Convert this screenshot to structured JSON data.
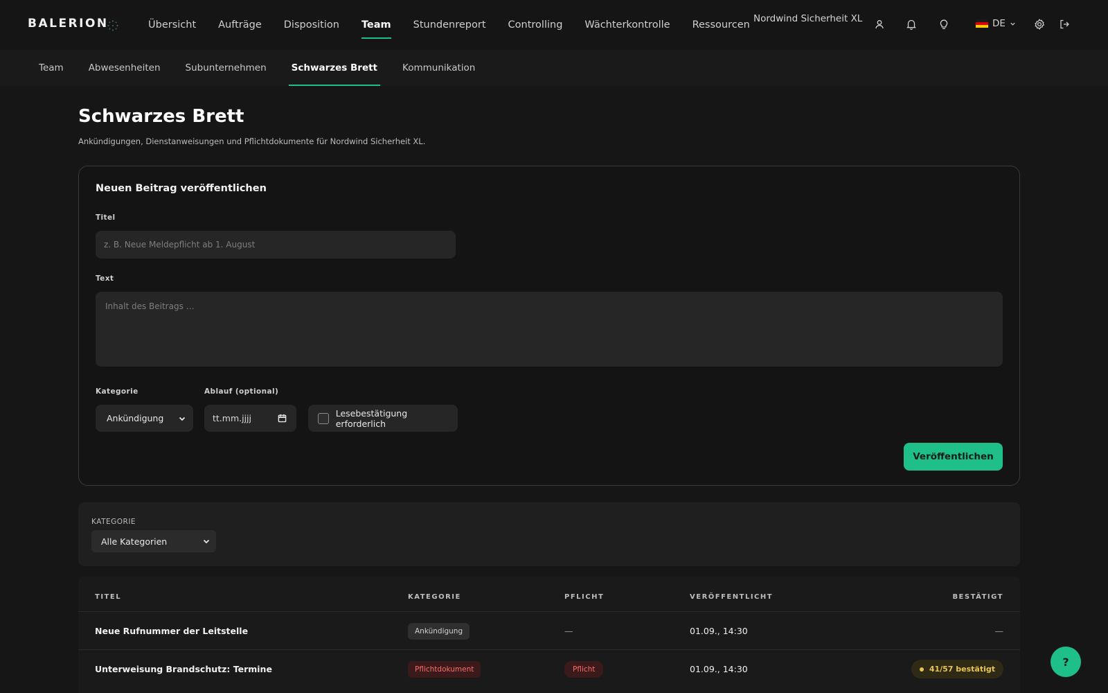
{
  "brand": {
    "logo": "BALERION",
    "logo_icon": "dots-icon"
  },
  "main_nav": [
    {
      "label": "Übersicht",
      "active": false
    },
    {
      "label": "Aufträge",
      "active": false
    },
    {
      "label": "Disposition",
      "active": false
    },
    {
      "label": "Team",
      "active": true
    },
    {
      "label": "Stundenreport",
      "active": false
    },
    {
      "label": "Controlling",
      "active": false
    },
    {
      "label": "Wächterkontrolle",
      "active": false
    },
    {
      "label": "Ressourcen",
      "active": false
    }
  ],
  "header": {
    "company": "Nordwind Sicherheit XL",
    "icons": [
      "user-icon",
      "bell-icon",
      "lightbulb-icon",
      "settings-icon",
      "logout-icon"
    ],
    "language": "DE"
  },
  "sub_nav": [
    {
      "label": "Team",
      "active": false
    },
    {
      "label": "Abwesenheiten",
      "active": false
    },
    {
      "label": "Subunternehmen",
      "active": false
    },
    {
      "label": "Schwarzes Brett",
      "active": true
    },
    {
      "label": "Kommunikation",
      "active": false
    }
  ],
  "page": {
    "title": "Schwarzes Brett",
    "subtitle": "Ankündigungen, Dienstanweisungen und Pflichtdokumente für Nordwind Sicherheit XL."
  },
  "form": {
    "heading": "Neuen Beitrag veröffentlichen",
    "title_label": "Titel",
    "title_placeholder": "z. B. Neue Meldepflicht ab 1. August",
    "text_label": "Text",
    "text_placeholder": "Inhalt des Beitrags …",
    "category_label": "Kategorie",
    "category_value": "Ankündigung",
    "expiry_label": "Ablauf (optional)",
    "expiry_placeholder": "tt.mm.jjjj",
    "read_receipt_label": "Lesebestätigung erforderlich",
    "read_receipt_checked": false,
    "publish_label": "Veröffentlichen"
  },
  "filter": {
    "label": "KATEGORIE",
    "value": "Alle Kategorien"
  },
  "table": {
    "headers": {
      "title": "TITEL",
      "category": "KATEGORIE",
      "required": "PFLICHT",
      "published": "VERÖFFENTLICHT",
      "confirmed": "BESTÄTIGT"
    },
    "rows": [
      {
        "title": "Neue Rufnummer der Leitstelle",
        "category": "Ankündigung",
        "category_kind": "ann",
        "required": "—",
        "published": "01.09., 14:30",
        "confirmed": "—"
      },
      {
        "title": "Unterweisung Brandschutz: Termine",
        "category": "Pflichtdokument",
        "category_kind": "doc",
        "required": "Pflicht",
        "published": "01.09., 14:30",
        "confirmed": "41/57 bestätigt"
      }
    ]
  },
  "help": {
    "label": "?"
  },
  "colors": {
    "accent": "#1fbf8a",
    "danger": "#ff6b6b",
    "warning": "#e8c64a",
    "background": "#161616"
  }
}
